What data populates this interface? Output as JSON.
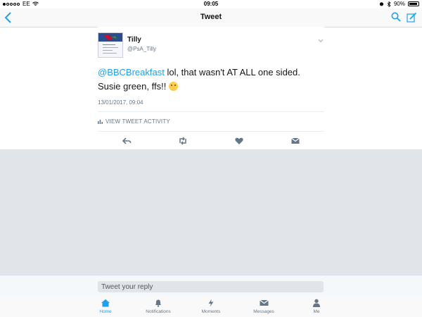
{
  "status_bar": {
    "carrier": "EE",
    "time": "09:05",
    "battery": "90%",
    "battery_level": 0.9
  },
  "nav": {
    "title": "Tweet",
    "back_icon": "chevron-left-icon",
    "search_icon": "search-icon",
    "compose_icon": "compose-icon"
  },
  "tweet": {
    "name": "Tilly",
    "handle": "@PsA_Tilly",
    "mention": "@BBCBreakfast",
    "body": " lol, that wasn't AT ALL one sided. Susie green, ffs!! ",
    "emoji": "smirk-face-emoji",
    "timestamp": "13/01/2017, 09:04",
    "activity_label": "VIEW TWEET ACTIVITY"
  },
  "actions": [
    "reply-icon",
    "retweet-icon",
    "like-icon",
    "direct-message-icon"
  ],
  "reply": {
    "placeholder": "Tweet your reply"
  },
  "tabs": [
    {
      "label": "Home",
      "icon": "home-icon",
      "active": true
    },
    {
      "label": "Notifications",
      "icon": "bell-icon",
      "active": false
    },
    {
      "label": "Moments",
      "icon": "lightning-icon",
      "active": false
    },
    {
      "label": "Messages",
      "icon": "envelope-icon",
      "active": false
    },
    {
      "label": "Me",
      "icon": "person-icon",
      "active": false
    }
  ],
  "colors": {
    "accent": "#1da1f2",
    "secondary_text": "#657786",
    "background_gray": "#e1e5ea"
  }
}
